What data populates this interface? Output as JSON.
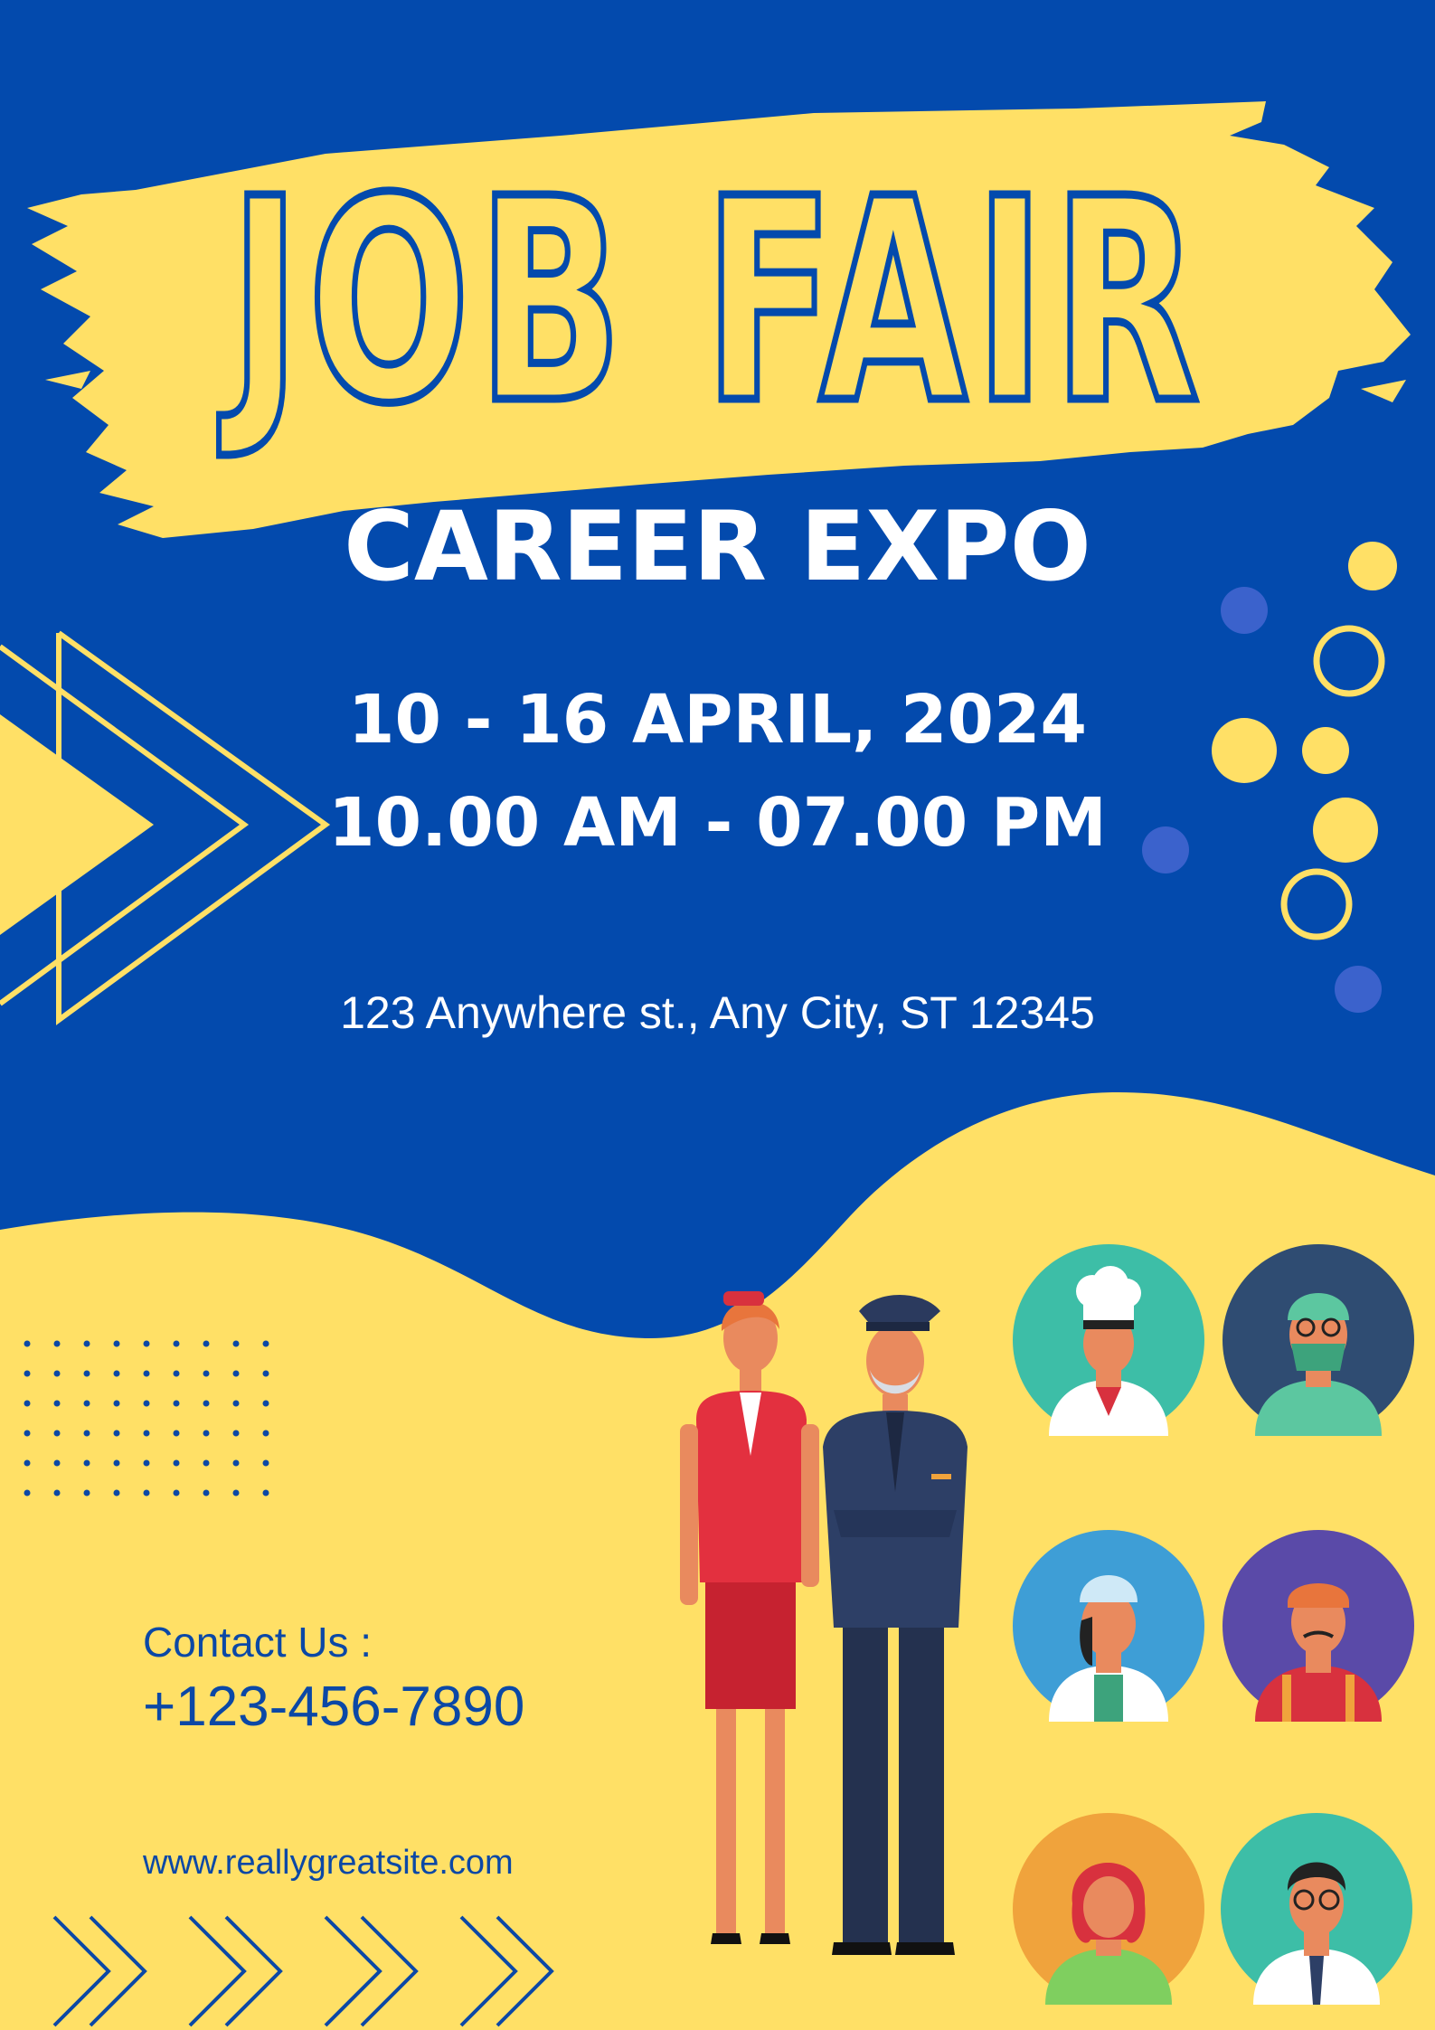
{
  "poster": {
    "title": "JOB FAIR",
    "subtitle": "CAREER EXPO",
    "dates": "10 - 16 APRIL, 2024",
    "hours": "10.00 AM - 07.00 PM",
    "address": "123 Anywhere st., Any City, ST 12345",
    "contact_label": "Contact Us :",
    "phone": "+123-456-7890",
    "website": "www.reallygreatsite.com"
  },
  "colors": {
    "blue": "#034aad",
    "yellow": "#ffe066",
    "white": "#ffffff",
    "text_blue": "#0b48a6"
  },
  "illustrations": {
    "featured": [
      "flight-attendant-icon",
      "pilot-icon"
    ],
    "avatars": [
      "chef-icon",
      "surgeon-icon",
      "nurse-icon",
      "craftsman-icon",
      "gardener-icon",
      "doctor-icon"
    ]
  }
}
